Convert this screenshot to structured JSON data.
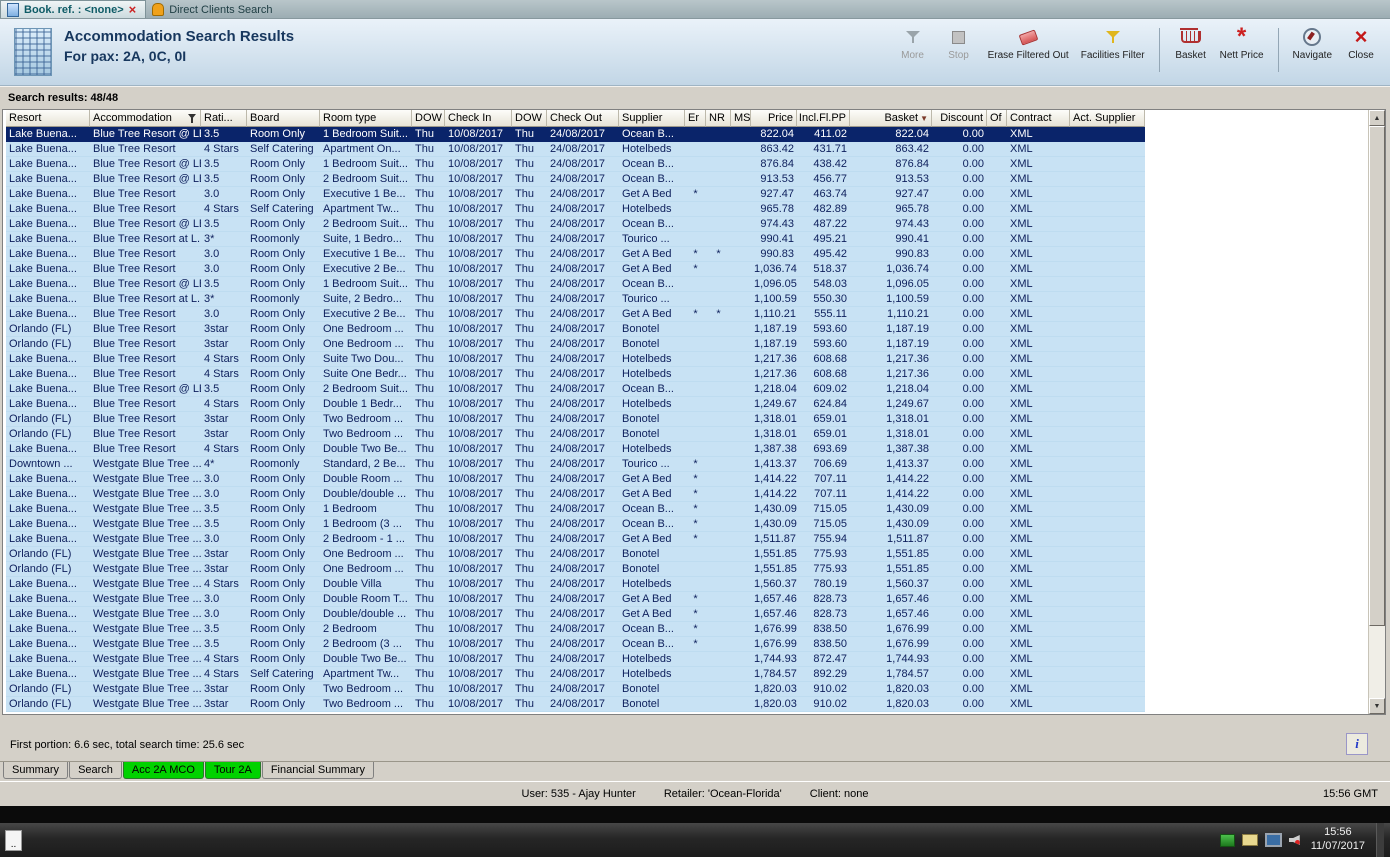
{
  "doc_tabs": [
    {
      "label": "Book. ref. : <none>",
      "closable": true,
      "icon": "document-icon"
    },
    {
      "label": "Direct Clients Search",
      "icon": "person-icon"
    }
  ],
  "header": {
    "title1": "Accommodation Search Results",
    "title2": "For pax: 2A, 0C, 0I",
    "toolbar": {
      "items": [
        {
          "label": "More",
          "icon": "more-filter-icon",
          "disabled": true
        },
        {
          "label": "Stop",
          "icon": "stop-icon",
          "disabled": true
        },
        {
          "label": "Erase Filtered Out",
          "icon": "eraser-icon"
        },
        {
          "label": "Facilities Filter",
          "icon": "funnel-icon"
        },
        {
          "label": "Basket",
          "icon": "basket-icon"
        },
        {
          "label": "Nett Price",
          "icon": "nett-price-icon"
        },
        {
          "label": "Navigate",
          "icon": "compass-icon"
        },
        {
          "label": "Close",
          "icon": "close-icon"
        }
      ]
    }
  },
  "results": {
    "summary": "Search results: 48/48",
    "columns": [
      "Resort",
      "Accommodation",
      "Rati...",
      "Board",
      "Room type",
      "DOW",
      "Check In",
      "DOW",
      "Check Out",
      "Supplier",
      "Er",
      "NR",
      "MS",
      "Price",
      "Incl.Fl.PP",
      "Basket",
      "Discount",
      "Of",
      "Contract",
      "Act. Supplier"
    ],
    "rows": [
      [
        "Lake Buena...",
        "Blue Tree Resort @ LBV",
        "3.5",
        "Room Only",
        "1 Bedroom Suit...",
        "Thu",
        "10/08/2017",
        "Thu",
        "24/08/2017",
        "Ocean B...",
        "",
        "",
        "",
        "822.04",
        "411.02",
        "822.04",
        "0.00",
        "",
        "XML",
        ""
      ],
      [
        "Lake Buena...",
        "Blue Tree Resort",
        "4 Stars",
        "Self Catering",
        "Apartment On...",
        "Thu",
        "10/08/2017",
        "Thu",
        "24/08/2017",
        "Hotelbeds",
        "",
        "",
        "",
        "863.42",
        "431.71",
        "863.42",
        "0.00",
        "",
        "XML",
        ""
      ],
      [
        "Lake Buena...",
        "Blue Tree Resort @ LBV",
        "3.5",
        "Room Only",
        "1 Bedroom Suit...",
        "Thu",
        "10/08/2017",
        "Thu",
        "24/08/2017",
        "Ocean B...",
        "",
        "",
        "",
        "876.84",
        "438.42",
        "876.84",
        "0.00",
        "",
        "XML",
        ""
      ],
      [
        "Lake Buena...",
        "Blue Tree Resort @ LBV",
        "3.5",
        "Room Only",
        "2 Bedroom Suit...",
        "Thu",
        "10/08/2017",
        "Thu",
        "24/08/2017",
        "Ocean B...",
        "",
        "",
        "",
        "913.53",
        "456.77",
        "913.53",
        "0.00",
        "",
        "XML",
        ""
      ],
      [
        "Lake Buena...",
        "Blue Tree Resort",
        "3.0",
        "Room Only",
        "Executive 1 Be...",
        "Thu",
        "10/08/2017",
        "Thu",
        "24/08/2017",
        "Get A Bed",
        "*",
        "",
        "",
        "927.47",
        "463.74",
        "927.47",
        "0.00",
        "",
        "XML",
        ""
      ],
      [
        "Lake Buena...",
        "Blue Tree Resort",
        "4 Stars",
        "Self Catering",
        "Apartment Tw...",
        "Thu",
        "10/08/2017",
        "Thu",
        "24/08/2017",
        "Hotelbeds",
        "",
        "",
        "",
        "965.78",
        "482.89",
        "965.78",
        "0.00",
        "",
        "XML",
        ""
      ],
      [
        "Lake Buena...",
        "Blue Tree Resort @ LBV",
        "3.5",
        "Room Only",
        "2 Bedroom Suit...",
        "Thu",
        "10/08/2017",
        "Thu",
        "24/08/2017",
        "Ocean B...",
        "",
        "",
        "",
        "974.43",
        "487.22",
        "974.43",
        "0.00",
        "",
        "XML",
        ""
      ],
      [
        "Lake Buena...",
        "Blue Tree Resort at L...",
        "3*",
        "Roomonly",
        "Suite, 1 Bedro...",
        "Thu",
        "10/08/2017",
        "Thu",
        "24/08/2017",
        "Tourico ...",
        "",
        "",
        "",
        "990.41",
        "495.21",
        "990.41",
        "0.00",
        "",
        "XML",
        ""
      ],
      [
        "Lake Buena...",
        "Blue Tree Resort",
        "3.0",
        "Room Only",
        "Executive 1 Be...",
        "Thu",
        "10/08/2017",
        "Thu",
        "24/08/2017",
        "Get A Bed",
        "*",
        "*",
        "",
        "990.83",
        "495.42",
        "990.83",
        "0.00",
        "",
        "XML",
        ""
      ],
      [
        "Lake Buena...",
        "Blue Tree Resort",
        "3.0",
        "Room Only",
        "Executive 2 Be...",
        "Thu",
        "10/08/2017",
        "Thu",
        "24/08/2017",
        "Get A Bed",
        "*",
        "",
        "",
        "1,036.74",
        "518.37",
        "1,036.74",
        "0.00",
        "",
        "XML",
        ""
      ],
      [
        "Lake Buena...",
        "Blue Tree Resort @ LBV",
        "3.5",
        "Room Only",
        "1 Bedroom Suit...",
        "Thu",
        "10/08/2017",
        "Thu",
        "24/08/2017",
        "Ocean B...",
        "",
        "",
        "",
        "1,096.05",
        "548.03",
        "1,096.05",
        "0.00",
        "",
        "XML",
        ""
      ],
      [
        "Lake Buena...",
        "Blue Tree Resort at L...",
        "3*",
        "Roomonly",
        "Suite, 2 Bedro...",
        "Thu",
        "10/08/2017",
        "Thu",
        "24/08/2017",
        "Tourico ...",
        "",
        "",
        "",
        "1,100.59",
        "550.30",
        "1,100.59",
        "0.00",
        "",
        "XML",
        ""
      ],
      [
        "Lake Buena...",
        "Blue Tree Resort",
        "3.0",
        "Room Only",
        "Executive 2 Be...",
        "Thu",
        "10/08/2017",
        "Thu",
        "24/08/2017",
        "Get A Bed",
        "*",
        "*",
        "",
        "1,110.21",
        "555.11",
        "1,110.21",
        "0.00",
        "",
        "XML",
        ""
      ],
      [
        "Orlando (FL)",
        "Blue Tree Resort",
        "3star",
        "Room Only",
        "One Bedroom ...",
        "Thu",
        "10/08/2017",
        "Thu",
        "24/08/2017",
        "Bonotel",
        "",
        "",
        "",
        "1,187.19",
        "593.60",
        "1,187.19",
        "0.00",
        "",
        "XML",
        ""
      ],
      [
        "Orlando (FL)",
        "Blue Tree Resort",
        "3star",
        "Room Only",
        "One Bedroom ...",
        "Thu",
        "10/08/2017",
        "Thu",
        "24/08/2017",
        "Bonotel",
        "",
        "",
        "",
        "1,187.19",
        "593.60",
        "1,187.19",
        "0.00",
        "",
        "XML",
        ""
      ],
      [
        "Lake Buena...",
        "Blue Tree Resort",
        "4 Stars",
        "Room Only",
        "Suite Two Dou...",
        "Thu",
        "10/08/2017",
        "Thu",
        "24/08/2017",
        "Hotelbeds",
        "",
        "",
        "",
        "1,217.36",
        "608.68",
        "1,217.36",
        "0.00",
        "",
        "XML",
        ""
      ],
      [
        "Lake Buena...",
        "Blue Tree Resort",
        "4 Stars",
        "Room Only",
        "Suite One Bedr...",
        "Thu",
        "10/08/2017",
        "Thu",
        "24/08/2017",
        "Hotelbeds",
        "",
        "",
        "",
        "1,217.36",
        "608.68",
        "1,217.36",
        "0.00",
        "",
        "XML",
        ""
      ],
      [
        "Lake Buena...",
        "Blue Tree Resort @ LBV",
        "3.5",
        "Room Only",
        "2 Bedroom Suit...",
        "Thu",
        "10/08/2017",
        "Thu",
        "24/08/2017",
        "Ocean B...",
        "",
        "",
        "",
        "1,218.04",
        "609.02",
        "1,218.04",
        "0.00",
        "",
        "XML",
        ""
      ],
      [
        "Lake Buena...",
        "Blue Tree Resort",
        "4 Stars",
        "Room Only",
        "Double 1 Bedr...",
        "Thu",
        "10/08/2017",
        "Thu",
        "24/08/2017",
        "Hotelbeds",
        "",
        "",
        "",
        "1,249.67",
        "624.84",
        "1,249.67",
        "0.00",
        "",
        "XML",
        ""
      ],
      [
        "Orlando (FL)",
        "Blue Tree Resort",
        "3star",
        "Room Only",
        "Two Bedroom ...",
        "Thu",
        "10/08/2017",
        "Thu",
        "24/08/2017",
        "Bonotel",
        "",
        "",
        "",
        "1,318.01",
        "659.01",
        "1,318.01",
        "0.00",
        "",
        "XML",
        ""
      ],
      [
        "Orlando (FL)",
        "Blue Tree Resort",
        "3star",
        "Room Only",
        "Two Bedroom ...",
        "Thu",
        "10/08/2017",
        "Thu",
        "24/08/2017",
        "Bonotel",
        "",
        "",
        "",
        "1,318.01",
        "659.01",
        "1,318.01",
        "0.00",
        "",
        "XML",
        ""
      ],
      [
        "Lake Buena...",
        "Blue Tree Resort",
        "4 Stars",
        "Room Only",
        "Double Two Be...",
        "Thu",
        "10/08/2017",
        "Thu",
        "24/08/2017",
        "Hotelbeds",
        "",
        "",
        "",
        "1,387.38",
        "693.69",
        "1,387.38",
        "0.00",
        "",
        "XML",
        ""
      ],
      [
        "Downtown ...",
        "Westgate Blue Tree ...",
        "4*",
        "Roomonly",
        "Standard, 2 Be...",
        "Thu",
        "10/08/2017",
        "Thu",
        "24/08/2017",
        "Tourico ...",
        "*",
        "",
        "",
        "1,413.37",
        "706.69",
        "1,413.37",
        "0.00",
        "",
        "XML",
        ""
      ],
      [
        "Lake Buena...",
        "Westgate Blue Tree ...",
        "3.0",
        "Room Only",
        "Double Room ...",
        "Thu",
        "10/08/2017",
        "Thu",
        "24/08/2017",
        "Get A Bed",
        "*",
        "",
        "",
        "1,414.22",
        "707.11",
        "1,414.22",
        "0.00",
        "",
        "XML",
        ""
      ],
      [
        "Lake Buena...",
        "Westgate Blue Tree ...",
        "3.0",
        "Room Only",
        "Double/double ...",
        "Thu",
        "10/08/2017",
        "Thu",
        "24/08/2017",
        "Get A Bed",
        "*",
        "",
        "",
        "1,414.22",
        "707.11",
        "1,414.22",
        "0.00",
        "",
        "XML",
        ""
      ],
      [
        "Lake Buena...",
        "Westgate Blue Tree ...",
        "3.5",
        "Room Only",
        "1 Bedroom",
        "Thu",
        "10/08/2017",
        "Thu",
        "24/08/2017",
        "Ocean B...",
        "*",
        "",
        "",
        "1,430.09",
        "715.05",
        "1,430.09",
        "0.00",
        "",
        "XML",
        ""
      ],
      [
        "Lake Buena...",
        "Westgate Blue Tree ...",
        "3.5",
        "Room Only",
        "1 Bedroom (3 ...",
        "Thu",
        "10/08/2017",
        "Thu",
        "24/08/2017",
        "Ocean B...",
        "*",
        "",
        "",
        "1,430.09",
        "715.05",
        "1,430.09",
        "0.00",
        "",
        "XML",
        ""
      ],
      [
        "Lake Buena...",
        "Westgate Blue Tree ...",
        "3.0",
        "Room Only",
        "2 Bedroom - 1 ...",
        "Thu",
        "10/08/2017",
        "Thu",
        "24/08/2017",
        "Get A Bed",
        "*",
        "",
        "",
        "1,511.87",
        "755.94",
        "1,511.87",
        "0.00",
        "",
        "XML",
        ""
      ],
      [
        "Orlando (FL)",
        "Westgate Blue Tree ...",
        "3star",
        "Room Only",
        "One Bedroom ...",
        "Thu",
        "10/08/2017",
        "Thu",
        "24/08/2017",
        "Bonotel",
        "",
        "",
        "",
        "1,551.85",
        "775.93",
        "1,551.85",
        "0.00",
        "",
        "XML",
        ""
      ],
      [
        "Orlando (FL)",
        "Westgate Blue Tree ...",
        "3star",
        "Room Only",
        "One Bedroom ...",
        "Thu",
        "10/08/2017",
        "Thu",
        "24/08/2017",
        "Bonotel",
        "",
        "",
        "",
        "1,551.85",
        "775.93",
        "1,551.85",
        "0.00",
        "",
        "XML",
        ""
      ],
      [
        "Lake Buena...",
        "Westgate Blue Tree ...",
        "4 Stars",
        "Room Only",
        "Double Villa",
        "Thu",
        "10/08/2017",
        "Thu",
        "24/08/2017",
        "Hotelbeds",
        "",
        "",
        "",
        "1,560.37",
        "780.19",
        "1,560.37",
        "0.00",
        "",
        "XML",
        ""
      ],
      [
        "Lake Buena...",
        "Westgate Blue Tree ...",
        "3.0",
        "Room Only",
        "Double Room T...",
        "Thu",
        "10/08/2017",
        "Thu",
        "24/08/2017",
        "Get A Bed",
        "*",
        "",
        "",
        "1,657.46",
        "828.73",
        "1,657.46",
        "0.00",
        "",
        "XML",
        ""
      ],
      [
        "Lake Buena...",
        "Westgate Blue Tree ...",
        "3.0",
        "Room Only",
        "Double/double ...",
        "Thu",
        "10/08/2017",
        "Thu",
        "24/08/2017",
        "Get A Bed",
        "*",
        "",
        "",
        "1,657.46",
        "828.73",
        "1,657.46",
        "0.00",
        "",
        "XML",
        ""
      ],
      [
        "Lake Buena...",
        "Westgate Blue Tree ...",
        "3.5",
        "Room Only",
        "2 Bedroom",
        "Thu",
        "10/08/2017",
        "Thu",
        "24/08/2017",
        "Ocean B...",
        "*",
        "",
        "",
        "1,676.99",
        "838.50",
        "1,676.99",
        "0.00",
        "",
        "XML",
        ""
      ],
      [
        "Lake Buena...",
        "Westgate Blue Tree ...",
        "3.5",
        "Room Only",
        "2 Bedroom (3 ...",
        "Thu",
        "10/08/2017",
        "Thu",
        "24/08/2017",
        "Ocean B...",
        "*",
        "",
        "",
        "1,676.99",
        "838.50",
        "1,676.99",
        "0.00",
        "",
        "XML",
        ""
      ],
      [
        "Lake Buena...",
        "Westgate Blue Tree ...",
        "4 Stars",
        "Room Only",
        "Double Two Be...",
        "Thu",
        "10/08/2017",
        "Thu",
        "24/08/2017",
        "Hotelbeds",
        "",
        "",
        "",
        "1,744.93",
        "872.47",
        "1,744.93",
        "0.00",
        "",
        "XML",
        ""
      ],
      [
        "Lake Buena...",
        "Westgate Blue Tree ...",
        "4 Stars",
        "Self Catering",
        "Apartment Tw...",
        "Thu",
        "10/08/2017",
        "Thu",
        "24/08/2017",
        "Hotelbeds",
        "",
        "",
        "",
        "1,784.57",
        "892.29",
        "1,784.57",
        "0.00",
        "",
        "XML",
        ""
      ],
      [
        "Orlando (FL)",
        "Westgate Blue Tree ...",
        "3star",
        "Room Only",
        "Two Bedroom ...",
        "Thu",
        "10/08/2017",
        "Thu",
        "24/08/2017",
        "Bonotel",
        "",
        "",
        "",
        "1,820.03",
        "910.02",
        "1,820.03",
        "0.00",
        "",
        "XML",
        ""
      ],
      [
        "Orlando (FL)",
        "Westgate Blue Tree ...",
        "3star",
        "Room Only",
        "Two Bedroom ...",
        "Thu",
        "10/08/2017",
        "Thu",
        "24/08/2017",
        "Bonotel",
        "",
        "",
        "",
        "1,820.03",
        "910.02",
        "1,820.03",
        "0.00",
        "",
        "XML",
        ""
      ]
    ],
    "selected_row_index": 0
  },
  "footer": {
    "timing": "First portion: 6.6 sec, total search time: 25.6 sec",
    "info_button": "i",
    "tabs": [
      {
        "label": "Summary",
        "style": "normal"
      },
      {
        "label": "Search",
        "style": "normal"
      },
      {
        "label": "Acc 2A MCO",
        "style": "green"
      },
      {
        "label": "Tour 2A",
        "style": "green"
      },
      {
        "label": "Financial Summary",
        "style": "normal"
      }
    ],
    "status": {
      "user": "User: 535 - Ajay Hunter",
      "retailer": "Retailer: 'Ocean-Florida'",
      "client": "Client: none",
      "time": "15:56 GMT"
    }
  },
  "taskbar": {
    "start": "..",
    "tray_icons": [
      "network-icon",
      "mail-icon",
      "display-icon",
      "volume-muted-icon"
    ],
    "time": "15:56",
    "date": "11/07/2017"
  }
}
